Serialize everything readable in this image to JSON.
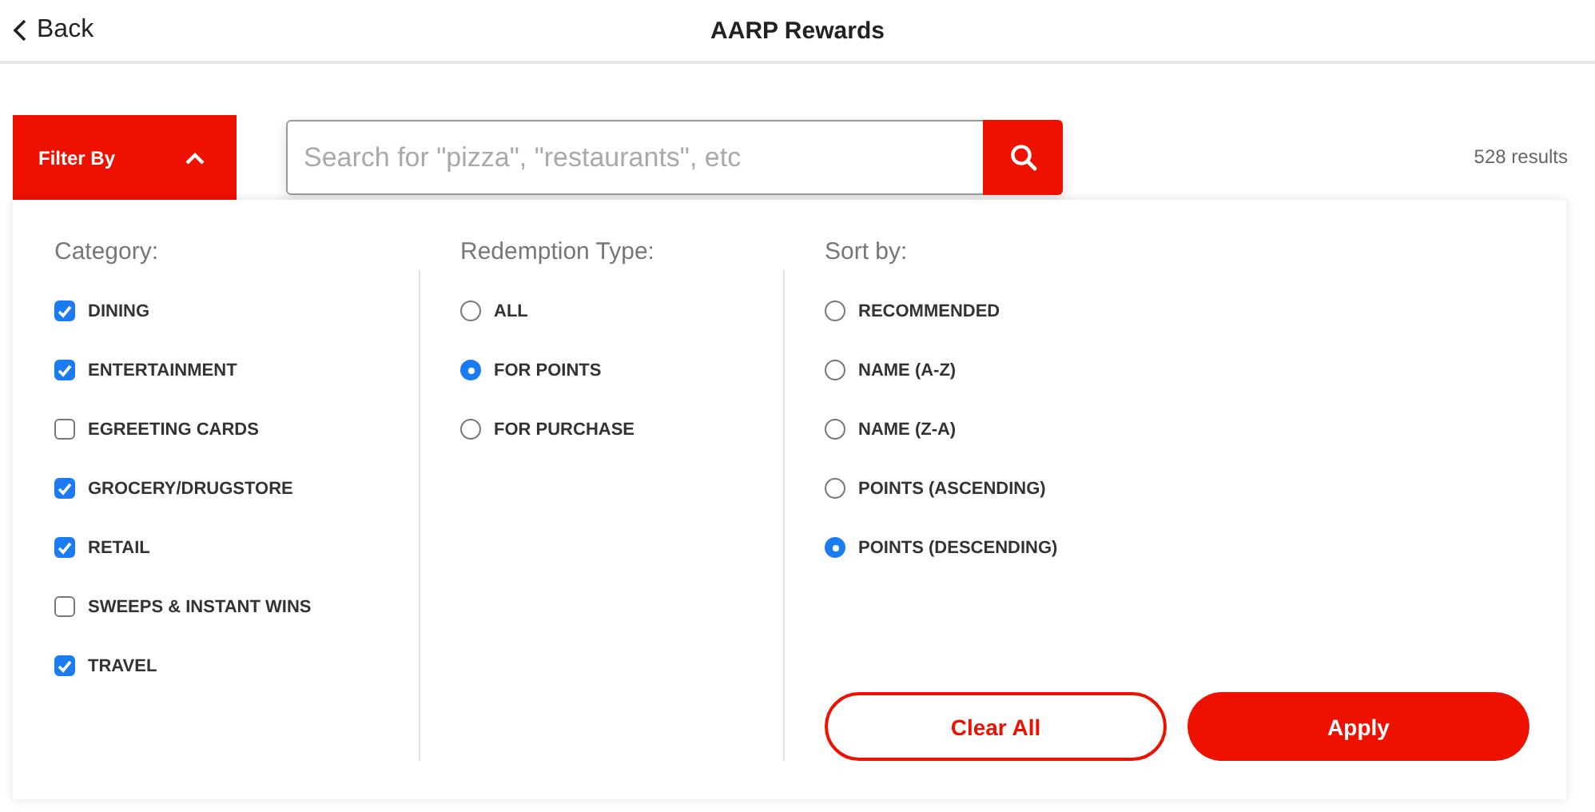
{
  "header": {
    "back_label": "Back",
    "title": "AARP Rewards"
  },
  "filter_toggle": {
    "label": "Filter By",
    "expanded": true
  },
  "search": {
    "placeholder": "Search for \"pizza\", \"restaurants\", etc"
  },
  "results_count": "528 results",
  "category": {
    "heading": "Category:",
    "items": [
      {
        "label": "DINING",
        "checked": true
      },
      {
        "label": "ENTERTAINMENT",
        "checked": true
      },
      {
        "label": "EGREETING CARDS",
        "checked": false
      },
      {
        "label": "GROCERY/DRUGSTORE",
        "checked": true
      },
      {
        "label": "RETAIL",
        "checked": true
      },
      {
        "label": "SWEEPS & INSTANT WINS",
        "checked": false
      },
      {
        "label": "TRAVEL",
        "checked": true
      }
    ]
  },
  "redemption_type": {
    "heading": "Redemption Type:",
    "options": [
      {
        "label": "ALL",
        "selected": false
      },
      {
        "label": "FOR POINTS",
        "selected": true
      },
      {
        "label": "FOR PURCHASE",
        "selected": false
      }
    ]
  },
  "sort_by": {
    "heading": "Sort by:",
    "options": [
      {
        "label": "RECOMMENDED",
        "selected": false
      },
      {
        "label": "NAME (A-Z)",
        "selected": false
      },
      {
        "label": "NAME (Z-A)",
        "selected": false
      },
      {
        "label": "POINTS (ASCENDING)",
        "selected": false
      },
      {
        "label": "POINTS (DESCENDING)",
        "selected": true
      }
    ]
  },
  "buttons": [
    {
      "label": "Clear All",
      "kind": "outline"
    },
    {
      "label": "Apply",
      "kind": "filled"
    }
  ]
}
